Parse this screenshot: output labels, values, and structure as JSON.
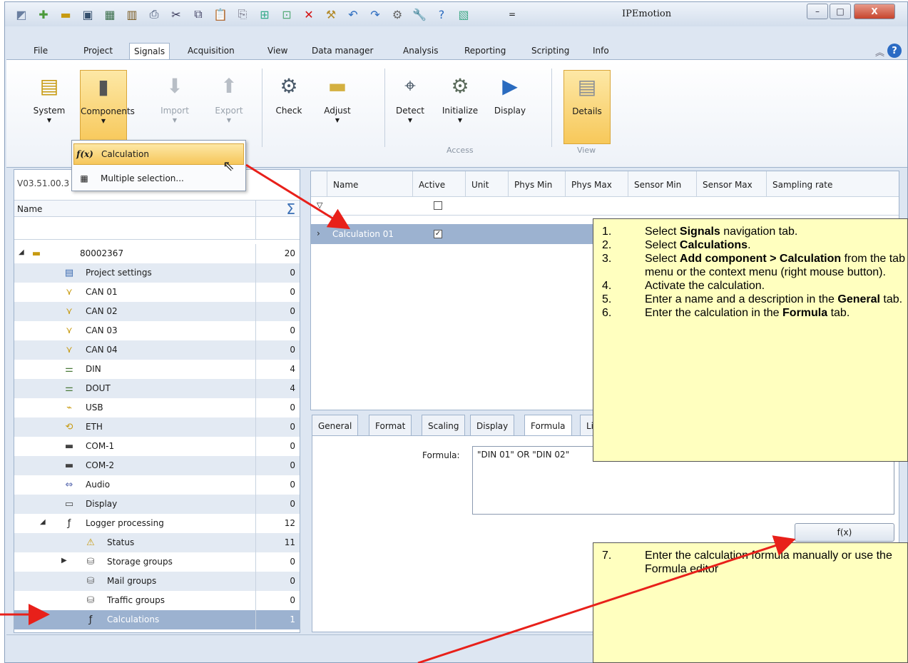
{
  "window": {
    "title": "IPEmotion",
    "quick_access": [
      "app-icon",
      "new-icon",
      "open-icon",
      "save-icon",
      "save-as-icon",
      "save-all-icon",
      "print-icon",
      "cut-icon",
      "copy-icon",
      "paste-icon",
      "paste-special-icon",
      "new-window-icon",
      "properties-icon",
      "delete-icon",
      "tools-icon",
      "undo-icon",
      "redo-icon",
      "settings-icon",
      "wrench-icon",
      "help-icon",
      "report-icon"
    ],
    "qat_dropdown": "=",
    "controls": {
      "minimize": "–",
      "maximize": "□",
      "close": "X"
    }
  },
  "menu": {
    "tabs": [
      "File",
      "Project",
      "Signals",
      "Acquisition",
      "View",
      "Data manager",
      "Analysis",
      "Reporting",
      "Scripting",
      "Info"
    ],
    "active_tab": "Signals",
    "help": "?"
  },
  "ribbon": {
    "buttons": [
      {
        "label": "System",
        "icon": "system-icon",
        "has_dropdown": true,
        "enabled": true
      },
      {
        "label": "Components",
        "icon": "components-icon",
        "has_dropdown": true,
        "enabled": true,
        "highlighted": true
      },
      {
        "label": "Import",
        "icon": "import-arrow-icon",
        "has_dropdown": true,
        "enabled": false
      },
      {
        "label": "Export",
        "icon": "export-arrow-icon",
        "has_dropdown": true,
        "enabled": false
      },
      {
        "label": "Check",
        "icon": "check-gear-icon",
        "has_dropdown": false,
        "enabled": true
      },
      {
        "label": "Adjust",
        "icon": "folder-icon",
        "has_dropdown": true,
        "enabled": true
      },
      {
        "label": "Detect",
        "icon": "binoculars-icon",
        "has_dropdown": true,
        "enabled": true
      },
      {
        "label": "Initialize",
        "icon": "gears-icon",
        "has_dropdown": true,
        "enabled": true
      },
      {
        "label": "Display",
        "icon": "play-icon",
        "has_dropdown": false,
        "enabled": true
      },
      {
        "label": "Details",
        "icon": "details-icon",
        "has_dropdown": false,
        "enabled": true,
        "highlighted": true
      }
    ],
    "groups": [
      "Access",
      "View"
    ]
  },
  "dropdown": {
    "items": [
      {
        "icon": "f(x)",
        "label": "Calculation",
        "hover": true
      },
      {
        "icon": "multi",
        "label": "Multiple selection..."
      }
    ]
  },
  "left_pane": {
    "version": "V03.51.00.3",
    "header": {
      "name": "Name",
      "sigma": "Σ"
    },
    "tree": [
      {
        "label": "80002367",
        "count": "20",
        "level": 0,
        "expander": "◢",
        "icon": "device-icon"
      },
      {
        "label": "Project settings",
        "count": "0",
        "level": 1,
        "icon": "settings-card-icon"
      },
      {
        "label": "CAN 01",
        "count": "0",
        "level": 1,
        "icon": "can-icon"
      },
      {
        "label": "CAN 02",
        "count": "0",
        "level": 1,
        "icon": "can-icon"
      },
      {
        "label": "CAN 03",
        "count": "0",
        "level": 1,
        "icon": "can-icon"
      },
      {
        "label": "CAN 04",
        "count": "0",
        "level": 1,
        "icon": "can-icon"
      },
      {
        "label": "DIN",
        "count": "4",
        "level": 1,
        "icon": "din-icon"
      },
      {
        "label": "DOUT",
        "count": "4",
        "level": 1,
        "icon": "dout-icon"
      },
      {
        "label": "USB",
        "count": "0",
        "level": 1,
        "icon": "usb-icon"
      },
      {
        "label": "ETH",
        "count": "0",
        "level": 1,
        "icon": "eth-icon"
      },
      {
        "label": "COM-1",
        "count": "0",
        "level": 1,
        "icon": "com-icon"
      },
      {
        "label": "COM-2",
        "count": "0",
        "level": 1,
        "icon": "com-icon"
      },
      {
        "label": "Audio",
        "count": "0",
        "level": 1,
        "icon": "audio-icon"
      },
      {
        "label": "Display",
        "count": "0",
        "level": 1,
        "icon": "display-icon"
      },
      {
        "label": "Logger processing",
        "count": "12",
        "level": 1,
        "expander": "◢",
        "icon": "fx-icon"
      },
      {
        "label": "Status",
        "count": "11",
        "level": 2,
        "icon": "status-icon"
      },
      {
        "label": "Storage groups",
        "count": "0",
        "level": 2,
        "expander": "▶",
        "icon": "database-icon"
      },
      {
        "label": "Mail groups",
        "count": "0",
        "level": 2,
        "icon": "database-icon"
      },
      {
        "label": "Traffic groups",
        "count": "0",
        "level": 2,
        "icon": "database-icon"
      },
      {
        "label": "Calculations",
        "count": "1",
        "level": 2,
        "icon": "fx-icon",
        "selected": true
      }
    ]
  },
  "grid": {
    "columns": [
      "Name",
      "Active",
      "Unit",
      "Phys Min",
      "Phys Max",
      "Sensor Min",
      "Sensor Max",
      "Sampling rate"
    ],
    "rows": [
      {
        "name": "Calculation 01",
        "active": true
      }
    ]
  },
  "detail": {
    "tabs": [
      "General",
      "Format",
      "Scaling",
      "Display",
      "Formula",
      "Li"
    ],
    "active_tab": "Formula",
    "formula_label": "Formula:",
    "formula_value": "\"DIN 01\" OR \"DIN 02\"",
    "fx_button": "f(x)"
  },
  "callout1": {
    "steps": [
      {
        "num": "1.",
        "parts": [
          [
            "Select ",
            false
          ],
          [
            "Signals",
            true
          ],
          [
            " navigation tab.",
            false
          ]
        ]
      },
      {
        "num": "2.",
        "parts": [
          [
            "Select ",
            false
          ],
          [
            "Calculations",
            true
          ],
          [
            ".",
            false
          ]
        ]
      },
      {
        "num": "3.",
        "parts": [
          [
            "Select ",
            false
          ],
          [
            "Add component > Calculation",
            true
          ],
          [
            " from the tab menu or the context menu (right mouse button).",
            false
          ]
        ]
      },
      {
        "num": "4.",
        "parts": [
          [
            "Activate the calculation.",
            false
          ]
        ]
      },
      {
        "num": "5.",
        "parts": [
          [
            "Enter a name and a description in the ",
            false
          ],
          [
            "General",
            true
          ],
          [
            " tab.",
            false
          ]
        ]
      },
      {
        "num": "6.",
        "parts": [
          [
            "Enter the calculation in the ",
            false
          ],
          [
            "Formula",
            true
          ],
          [
            " tab.",
            false
          ]
        ]
      }
    ]
  },
  "callout2": {
    "steps": [
      {
        "num": "7.",
        "parts": [
          [
            "Enter the calculation formula manually or use the Formula editor",
            false
          ]
        ]
      }
    ]
  },
  "colors": {
    "accent": "#f7c85a",
    "selection": "#9cb2d0",
    "callout_bg": "#ffffbf",
    "arrow": "#e8201a"
  }
}
